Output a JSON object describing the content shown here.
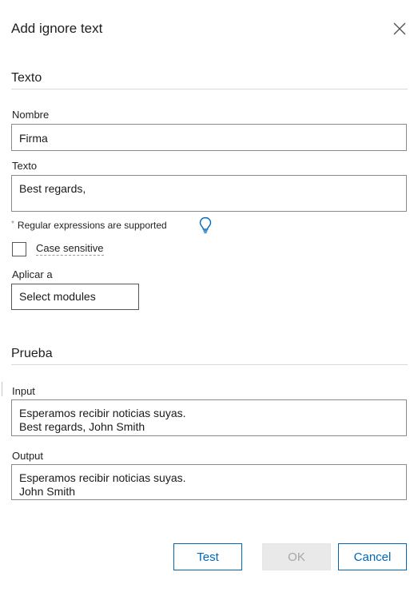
{
  "dialog": {
    "title": "Add ignore text",
    "close_icon": "close-icon"
  },
  "texto_section": {
    "heading": "Texto",
    "name_label": "Nombre",
    "name_value": "Firma",
    "text_label": "Texto",
    "text_value": "Best regards,",
    "hint_marker": "*",
    "hint_text": "Regular expressions are supported",
    "hint_icon": "lightbulb-icon",
    "case_sensitive_label": "Case sensitive",
    "case_sensitive_checked": false,
    "apply_label": "Aplicar a",
    "apply_value": "Select modules"
  },
  "prueba_section": {
    "heading": "Prueba",
    "input_label": "Input",
    "input_lines": [
      "Esperamos recibir noticias suyas.",
      "Best regards, John Smith"
    ],
    "output_label": "Output",
    "output_lines": [
      "Esperamos recibir noticias suyas.",
      "John Smith"
    ]
  },
  "buttons": {
    "test": "Test",
    "ok": "OK",
    "cancel": "Cancel"
  },
  "colors": {
    "accent": "#0067b8",
    "disabled_bg": "#e9e9e9",
    "disabled_text": "#a6a6a6",
    "field_border": "#8a8a8a",
    "divider": "#d9d9d9"
  }
}
